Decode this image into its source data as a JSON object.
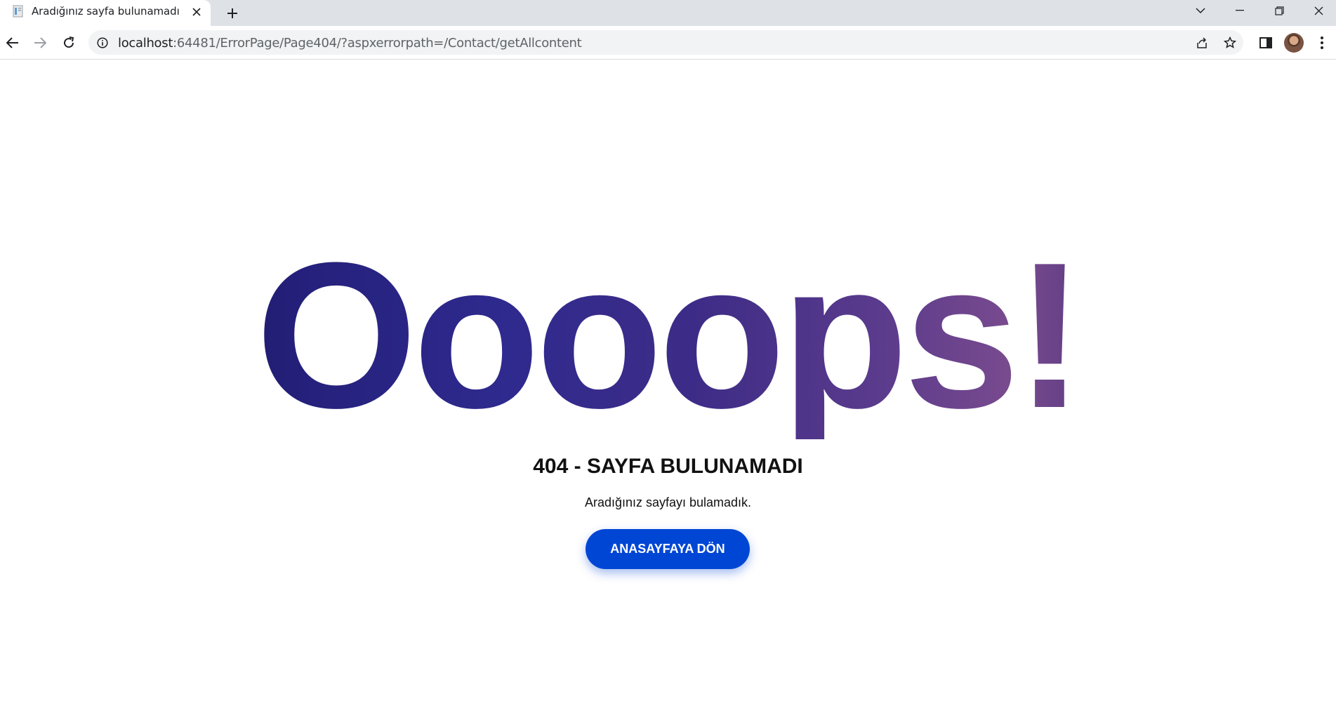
{
  "browser": {
    "tab": {
      "title": "Aradığınız sayfa bulunamadı",
      "favicon": "page-icon"
    },
    "address_bar": {
      "url_host": "localhost",
      "url_rest": ":64481/ErrorPage/Page404/?aspxerrorpath=/Contact/getAllcontent"
    },
    "icons": [
      "back-icon",
      "forward-icon",
      "reload-icon",
      "info-icon",
      "share-icon",
      "star-icon",
      "side-panel-icon",
      "menu-icon",
      "tab-search-icon",
      "minimize-icon",
      "restore-icon",
      "close-icon",
      "new-tab-icon"
    ]
  },
  "page": {
    "oops_text": "Oooops!",
    "headline": "404 - SAYFA BULUNAMADI",
    "message": "Aradığınız sayfayı bulamadık.",
    "home_button": "ANASAYFAYA DÖN"
  },
  "colors": {
    "button": "#0046d5",
    "text_gradient": [
      "#120f3d",
      "#2f2a8e",
      "#7a4b8e",
      "#121035"
    ]
  }
}
